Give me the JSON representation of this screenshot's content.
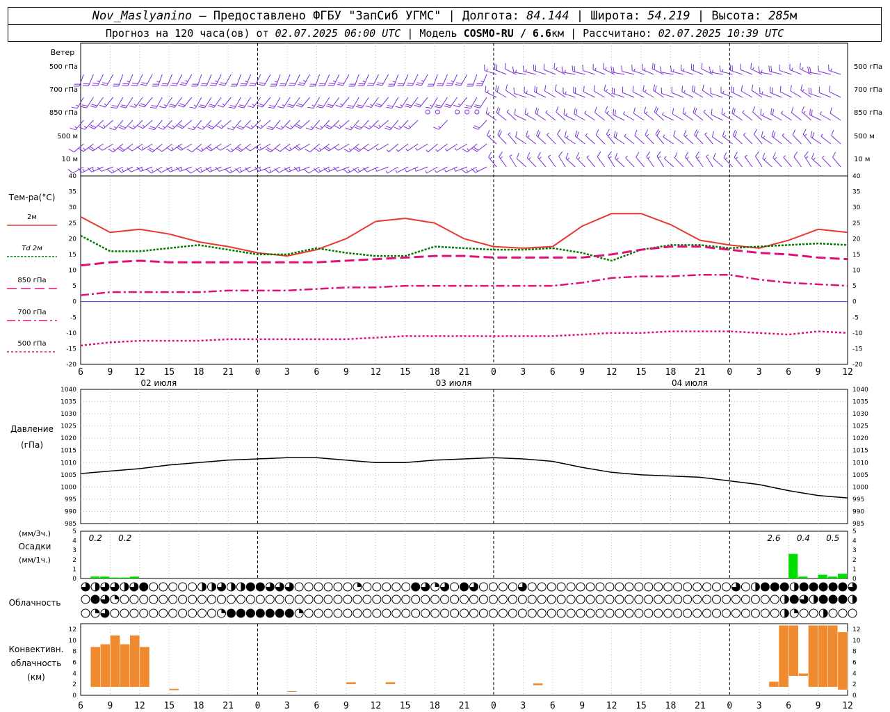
{
  "header": {
    "station": "Nov_Maslyanino",
    "provided_by": "— Предоставлено ФГБУ \"ЗапСиб УГМС\" |",
    "lon_label": "Долгота:",
    "lon_value": "84.144",
    "lat_label": "| Широта:",
    "lat_value": "54.219",
    "alt_label": "| Высота:",
    "alt_value": "285",
    "alt_unit": "м",
    "forecast_label": "Прогноз на 120 часа(ов) от",
    "forecast_start": "02.07.2025 06:00 UTC",
    "model_label": "| Модель",
    "model_name": "COSMO-RU / 6.6",
    "model_unit": "км",
    "calc_label": "| Рассчитано:",
    "calc_time": "02.07.2025 10:39 UTC"
  },
  "colors": {
    "wind": "#7b2fd6",
    "t2m": "#e8382f",
    "td2m": "#007a00",
    "t850": "#e0107a",
    "t700": "#e0107a",
    "t500": "#e0107a",
    "zero_line": "#3333cc",
    "pressure": "#000000",
    "precip": "#00dd00",
    "convective": "#f08a2e"
  },
  "wind": {
    "title": "Ветер",
    "levels": [
      "500 гПа",
      "700 гПа",
      "850 гПа",
      "500 м",
      "10 м"
    ]
  },
  "time_axis": {
    "hour_labels": [
      "6",
      "9",
      "12",
      "15",
      "18",
      "21",
      "0",
      "3",
      "6",
      "9",
      "12",
      "15",
      "18",
      "21",
      "0",
      "3",
      "6",
      "9",
      "12",
      "15",
      "18",
      "21",
      "0",
      "3",
      "6",
      "9",
      "12"
    ],
    "day_labels": [
      "02 июля",
      "03 июля",
      "04 июля"
    ]
  },
  "chart_data": [
    {
      "type": "line",
      "title": "Тем-ра(°C)",
      "x_hours": [
        0,
        3,
        6,
        9,
        12,
        15,
        18,
        21,
        24,
        27,
        30,
        33,
        36,
        39,
        42,
        45,
        48,
        51,
        54,
        57,
        60,
        63,
        66,
        69,
        72,
        75,
        78
      ],
      "ylim": [
        -20,
        40
      ],
      "series": [
        {
          "name": "2м",
          "values": [
            27,
            22,
            23,
            21.5,
            19,
            17.5,
            15.5,
            14.5,
            16.5,
            20,
            25.5,
            26.5,
            25,
            20,
            17.5,
            17,
            17.5,
            24,
            28,
            28,
            24.5,
            19.5,
            18,
            17,
            19.5,
            23,
            22
          ]
        },
        {
          "name": "Td 2м",
          "values": [
            21,
            16,
            16,
            17,
            18,
            16.5,
            15,
            15,
            17,
            15.5,
            14.5,
            14.5,
            17.5,
            17,
            16.5,
            16.5,
            17,
            15.5,
            13,
            16.5,
            18,
            18,
            17,
            17.5,
            18,
            18.5,
            18
          ]
        },
        {
          "name": "850 гПа",
          "values": [
            11.5,
            12.5,
            13,
            12.5,
            12.5,
            12.5,
            12.5,
            12.5,
            12.5,
            13,
            13.5,
            14,
            14.5,
            14.5,
            14,
            14,
            14,
            14,
            15,
            16.5,
            17.5,
            17.5,
            16.5,
            15.5,
            15,
            14,
            13.5
          ]
        },
        {
          "name": "700 гПа",
          "values": [
            2,
            3,
            3,
            3,
            3,
            3.5,
            3.5,
            3.5,
            4,
            4.5,
            4.5,
            5,
            5,
            5,
            5,
            5,
            5,
            6,
            7.5,
            8,
            8,
            8.5,
            8.5,
            7,
            6,
            5.5,
            5
          ]
        },
        {
          "name": "500 гПа",
          "values": [
            -14,
            -13,
            -12.5,
            -12.5,
            -12.5,
            -12,
            -12,
            -12,
            -12,
            -12,
            -11.5,
            -11,
            -11,
            -11,
            -11,
            -11,
            -11,
            -10.5,
            -10,
            -10,
            -9.5,
            -9.5,
            -9.5,
            -10,
            -10.5,
            -9.5,
            -10
          ]
        }
      ],
      "y_ticks": [
        40,
        35,
        30,
        25,
        20,
        15,
        10,
        5,
        0,
        -5,
        -10,
        -15,
        -20
      ]
    },
    {
      "type": "line",
      "title": "Давление",
      "unit": "(гПа)",
      "x_hours": [
        0,
        3,
        6,
        9,
        12,
        15,
        18,
        21,
        24,
        27,
        30,
        33,
        36,
        39,
        42,
        45,
        48,
        51,
        54,
        57,
        60,
        63,
        66,
        69,
        72,
        75,
        78
      ],
      "ylim": [
        985,
        1040
      ],
      "series": [
        {
          "name": "",
          "values": [
            1005.5,
            1006.5,
            1007.5,
            1009,
            1010,
            1011,
            1011.5,
            1012,
            1012,
            1011,
            1010,
            1010,
            1011,
            1011.5,
            1012,
            1011.5,
            1010.5,
            1008,
            1006,
            1005,
            1004.5,
            1004,
            1002.5,
            1001,
            998.5,
            996.5,
            995.5
          ]
        }
      ],
      "y_ticks": [
        1040,
        1035,
        1030,
        1025,
        1020,
        1015,
        1010,
        1005,
        1000,
        995,
        990,
        985
      ]
    },
    {
      "type": "bar",
      "title": "Осадки",
      "unit_top": "(мм/3ч.)",
      "unit_bottom": "(мм/1ч.)",
      "ylim": [
        0,
        5
      ],
      "bars_x_hours": [
        1,
        2,
        3,
        4,
        5,
        72,
        73,
        74,
        75,
        76,
        77
      ],
      "values": [
        0.2,
        0.2,
        0.1,
        0.1,
        0.2,
        2.6,
        0.2,
        0.0,
        0.4,
        0.2,
        0.5
      ],
      "annotations": [
        {
          "x_hour": 1.5,
          "text": "0.2"
        },
        {
          "x_hour": 4.5,
          "text": "0.2"
        },
        {
          "x_hour": 70.5,
          "text": "2.6"
        },
        {
          "x_hour": 73.5,
          "text": "0.4"
        },
        {
          "x_hour": 76.5,
          "text": "0.5"
        }
      ],
      "y_ticks": [
        5,
        4,
        3,
        2,
        1,
        0
      ]
    },
    {
      "type": "table",
      "title": "Облачность",
      "note": "cloud cover symbols per hour (0..4 quarters), three layers",
      "rows": [
        [
          3,
          2,
          3,
          3,
          2,
          3,
          4,
          0,
          0,
          0,
          0,
          0,
          2,
          2,
          3,
          2,
          2,
          4,
          4,
          3,
          3,
          3,
          0,
          0,
          0,
          0,
          0,
          0,
          1,
          0,
          0,
          0,
          0,
          0,
          4,
          3,
          1,
          3,
          0,
          4,
          3,
          0,
          0,
          0,
          0,
          3,
          0,
          0,
          0,
          0,
          0,
          0,
          0,
          0,
          0,
          0,
          0,
          0,
          0,
          0,
          0,
          0,
          0,
          0,
          0,
          0,
          0,
          3,
          0,
          2,
          4,
          4,
          4,
          2,
          4,
          4,
          4,
          4,
          4,
          3
        ],
        [
          0,
          4,
          3,
          1,
          0,
          0,
          0,
          0,
          0,
          0,
          0,
          0,
          0,
          0,
          0,
          0,
          0,
          0,
          0,
          0,
          0,
          0,
          0,
          0,
          0,
          0,
          0,
          0,
          0,
          0,
          0,
          0,
          0,
          0,
          0,
          0,
          0,
          0,
          0,
          0,
          0,
          0,
          0,
          0,
          0,
          0,
          0,
          0,
          0,
          0,
          0,
          0,
          0,
          0,
          0,
          0,
          0,
          0,
          0,
          0,
          0,
          0,
          0,
          0,
          0,
          0,
          0,
          0,
          0,
          0,
          0,
          0,
          2,
          4,
          3,
          2,
          4,
          4,
          4,
          2
        ],
        [
          0,
          1,
          3,
          0,
          0,
          0,
          0,
          0,
          0,
          0,
          0,
          0,
          0,
          0,
          1,
          4,
          4,
          4,
          4,
          4,
          4,
          4,
          1,
          0,
          0,
          0,
          0,
          0,
          0,
          0,
          0,
          0,
          0,
          0,
          0,
          0,
          0,
          0,
          0,
          0,
          0,
          0,
          0,
          0,
          0,
          0,
          0,
          0,
          0,
          0,
          0,
          0,
          0,
          0,
          0,
          0,
          0,
          0,
          0,
          0,
          0,
          0,
          0,
          0,
          0,
          0,
          0,
          0,
          0,
          0,
          0,
          0,
          2,
          1,
          0,
          0,
          2,
          0,
          0,
          0
        ]
      ]
    },
    {
      "type": "bar",
      "title": "Конвективн. облачность",
      "unit": "(км)",
      "ylim": [
        0,
        13
      ],
      "y_ticks": [
        12,
        10,
        8,
        6,
        4,
        2,
        0
      ],
      "layers": [
        {
          "x_hour": 1.5,
          "base": 1.5,
          "top": 8.8
        },
        {
          "x_hour": 2.5,
          "base": 1.5,
          "top": 9.3
        },
        {
          "x_hour": 3.5,
          "base": 1.5,
          "top": 10.9
        },
        {
          "x_hour": 4.5,
          "base": 1.5,
          "top": 9.3
        },
        {
          "x_hour": 5.5,
          "base": 1.5,
          "top": 10.9
        },
        {
          "x_hour": 6.5,
          "base": 1.5,
          "top": 8.8
        },
        {
          "x_hour": 9.5,
          "base": 0.9,
          "top": 1.2
        },
        {
          "x_hour": 21.5,
          "base": 0.6,
          "top": 0.8
        },
        {
          "x_hour": 27.5,
          "base": 2.0,
          "top": 2.4
        },
        {
          "x_hour": 31.5,
          "base": 2.0,
          "top": 2.4
        },
        {
          "x_hour": 46.5,
          "base": 1.8,
          "top": 2.2
        },
        {
          "x_hour": 70.5,
          "base": 1.5,
          "top": 2.5
        },
        {
          "x_hour": 71.5,
          "base": 1.5,
          "top": 12.7
        },
        {
          "x_hour": 72.5,
          "base": 3.5,
          "top": 12.7
        },
        {
          "x_hour": 73.5,
          "base": 3.5,
          "top": 4.0
        },
        {
          "x_hour": 74.5,
          "base": 1.5,
          "top": 12.7
        },
        {
          "x_hour": 75.5,
          "base": 1.5,
          "top": 12.7
        },
        {
          "x_hour": 76.5,
          "base": 1.5,
          "top": 12.7
        },
        {
          "x_hour": 77.5,
          "base": 1.0,
          "top": 11.5
        }
      ]
    }
  ]
}
